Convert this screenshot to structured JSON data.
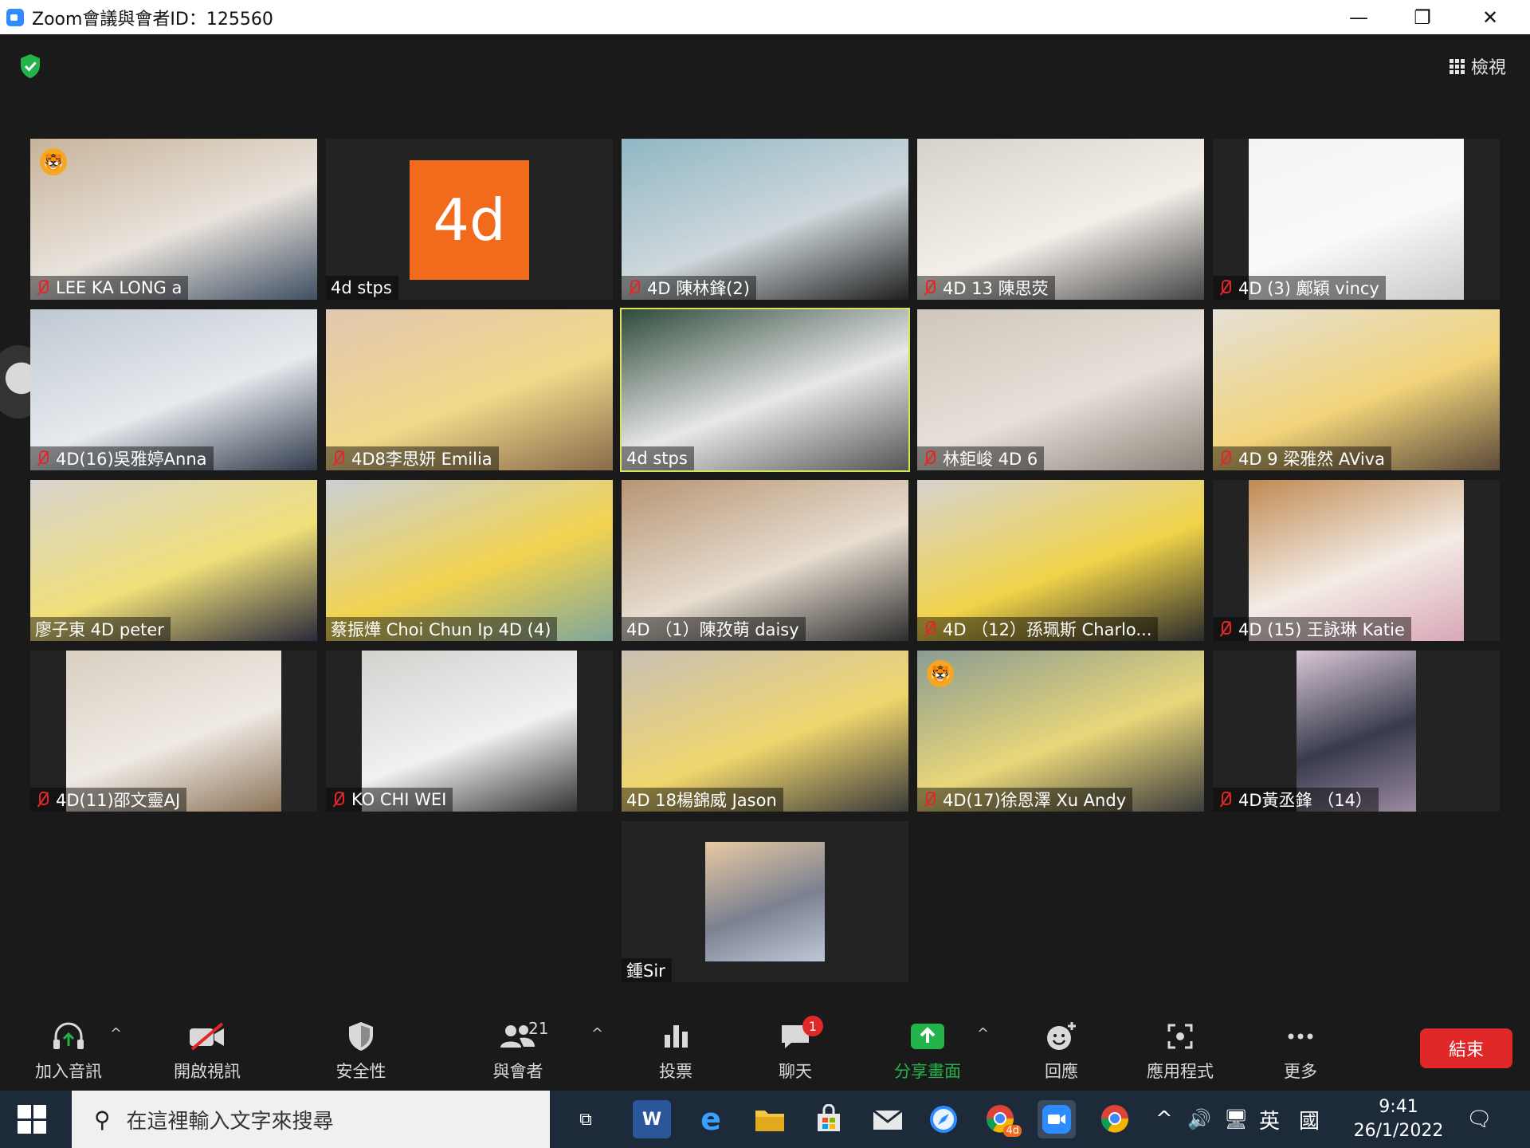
{
  "window": {
    "title": "Zoom會議與會者ID：125560",
    "minimize": "—",
    "restore": "❐",
    "close": "✕"
  },
  "header": {
    "view_label": "檢視"
  },
  "tiles": [
    {
      "name": "LEE KA LONG    a",
      "muted": true,
      "colors": [
        "#c7b39a",
        "#e9e3dc",
        "#3f4f63"
      ]
    },
    {
      "name": "4d stps",
      "muted": false,
      "logo": "4d"
    },
    {
      "name": "4D 陳林鋒(2)",
      "muted": true,
      "colors": [
        "#8fb7c4",
        "#cfd8dc",
        "#202020"
      ]
    },
    {
      "name": "4D 13 陳思荧",
      "muted": true,
      "colors": [
        "#d7d1cc",
        "#f4efe9",
        "#444"
      ]
    },
    {
      "name": "4D (3) 鄺穎 vincy",
      "muted": true,
      "colors": [
        "#f3f3f3",
        "#fafafa",
        "#c9c9c9"
      ]
    },
    {
      "name": "4D(16)吳雅婷Anna",
      "muted": true,
      "colors": [
        "#bfc8d2",
        "#e7eaee",
        "#2f3a4a"
      ]
    },
    {
      "name": "4D8李思妍 Emilia",
      "muted": true,
      "colors": [
        "#e2c6b0",
        "#f1d98a",
        "#8a6a4a"
      ]
    },
    {
      "name": "4d stps",
      "muted": false,
      "colors": [
        "#2e4a3a",
        "#e8e8e8",
        "#555"
      ]
    },
    {
      "name": "林鉅峻 4D 6",
      "muted": true,
      "colors": [
        "#cfc7bd",
        "#e6e0d8",
        "#8b8178"
      ]
    },
    {
      "name": "4D 9 梁雅然 AViva",
      "muted": true,
      "colors": [
        "#e5e0d6",
        "#f2d47a",
        "#5b4a3a"
      ]
    },
    {
      "name": "廖子東 4D peter",
      "muted": false,
      "colors": [
        "#d8d4cf",
        "#f0e07a",
        "#2a2a3a"
      ]
    },
    {
      "name": "蔡振燁 Choi Chun Ip 4D (4)",
      "muted": false,
      "colors": [
        "#c9cfd4",
        "#f2d350",
        "#7fa69a"
      ]
    },
    {
      "name": "4D （1）陳孜萌 daisy",
      "muted": false,
      "colors": [
        "#b79574",
        "#e7ddd0",
        "#2d2d2d"
      ]
    },
    {
      "name": "4D （12）孫珮斯 Charlo...",
      "muted": true,
      "colors": [
        "#d6d3cf",
        "#f0d34a",
        "#2a2a2a"
      ]
    },
    {
      "name": "4D (15) 王詠琳 Katie",
      "muted": true,
      "colors": [
        "#c08a52",
        "#f3ece5",
        "#d9a7b7"
      ]
    },
    {
      "name": "4D(11)邵文靈AJ",
      "muted": true,
      "colors": [
        "#d9cfc2",
        "#efeae4",
        "#8c7358"
      ]
    },
    {
      "name": "KO CHI WEI",
      "muted": true,
      "colors": [
        "#d4d2cf",
        "#f1f1f1",
        "#333"
      ]
    },
    {
      "name": "4D 18楊錦威 Jason",
      "muted": false,
      "colors": [
        "#c9c0b4",
        "#f0d66e",
        "#3a3a3a"
      ]
    },
    {
      "name": "4D(17)徐恩澤 Xu Andy",
      "muted": true,
      "colors": [
        "#8b9c92",
        "#e9d77a",
        "#3b3b3b"
      ]
    },
    {
      "name": "4D黃丞鋒 （14）",
      "muted": true,
      "colors": [
        "#d9c7d6",
        "#383b4c",
        "#9b8aa1"
      ]
    },
    {
      "name": "鍾Sir",
      "muted": false,
      "colors": [
        "#e8c9a3",
        "#7b8190",
        "#bfc7d6"
      ]
    }
  ],
  "toolbar": {
    "audio_label": "加入音訊",
    "video_label": "開啟視訊",
    "security_label": "安全性",
    "participants_label": "與會者",
    "participants_count": "21",
    "polls_label": "投票",
    "chat_label": "聊天",
    "chat_badge": "1",
    "share_label": "分享畫面",
    "reactions_label": "回應",
    "apps_label": "應用程式",
    "more_label": "更多",
    "end_label": "結束",
    "caret": "^"
  },
  "taskbar": {
    "search_placeholder": "在這裡輸入文字來搜尋",
    "chrome_badge": "4d",
    "ime_label": "英",
    "time": "9:41",
    "date": "26/1/2022",
    "word_label": "W",
    "edge_label": "e",
    "tray_caret": "^",
    "volume": "🔊",
    "network": "🖥",
    "ime_extra": "國",
    "notification": "🗨",
    "task_view": "⧉"
  }
}
